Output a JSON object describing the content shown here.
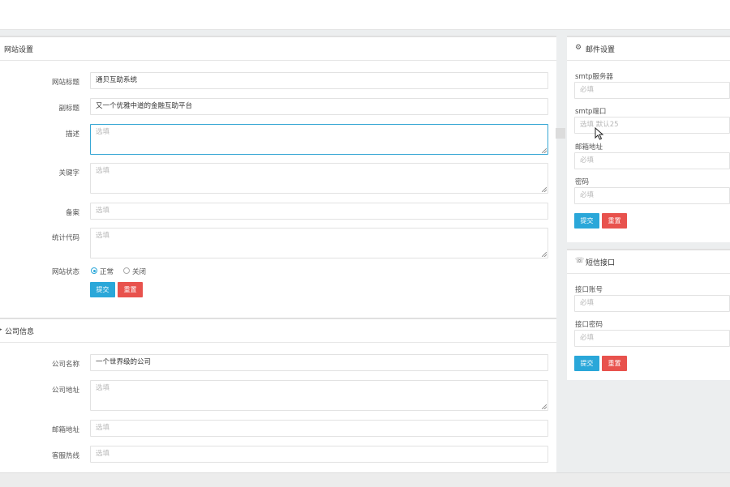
{
  "site_settings": {
    "title": "网站设置",
    "fields": [
      {
        "label": "网站标题",
        "value": "通贝互助系统",
        "placeholder": ""
      },
      {
        "label": "副标题",
        "value": "又一个优雅中道的金融互助平台",
        "placeholder": ""
      },
      {
        "label": "描述",
        "value": "",
        "placeholder": "选填"
      },
      {
        "label": "关键字",
        "value": "",
        "placeholder": "选填"
      },
      {
        "label": "备案",
        "value": "",
        "placeholder": "选填"
      },
      {
        "label": "统计代码",
        "value": "",
        "placeholder": "选填"
      }
    ],
    "status": {
      "label": "网站状态",
      "options": [
        "正常",
        "关闭"
      ],
      "selected": "正常"
    },
    "submit": "提交",
    "reset": "重置"
  },
  "company_info": {
    "title": "公司信息",
    "fields": [
      {
        "label": "公司名称",
        "value": "一个世界级的公司",
        "placeholder": ""
      },
      {
        "label": "公司地址",
        "value": "",
        "placeholder": "选填"
      },
      {
        "label": "邮箱地址",
        "value": "",
        "placeholder": "选填"
      },
      {
        "label": "客服热线",
        "value": "",
        "placeholder": "选填"
      }
    ]
  },
  "mail_settings": {
    "title": "邮件设置",
    "fields": [
      {
        "label": "smtp服务器",
        "placeholder": "必填"
      },
      {
        "label": "smtp端口",
        "placeholder": "选填 默认25"
      },
      {
        "label": "邮箱地址",
        "placeholder": "必填"
      },
      {
        "label": "密码",
        "placeholder": "必填"
      }
    ],
    "submit": "提交",
    "reset": "重置"
  },
  "sms_api": {
    "title": "短信接口",
    "fields": [
      {
        "label": "接口账号",
        "placeholder": "必填"
      },
      {
        "label": "接口密码",
        "placeholder": "必填"
      }
    ],
    "submit": "提交",
    "reset": "重置"
  },
  "icons": {
    "panel": "settings-icon",
    "mail": "gear-icon",
    "sms": "chat-icon",
    "cursor": "mouse-cursor-icon"
  }
}
